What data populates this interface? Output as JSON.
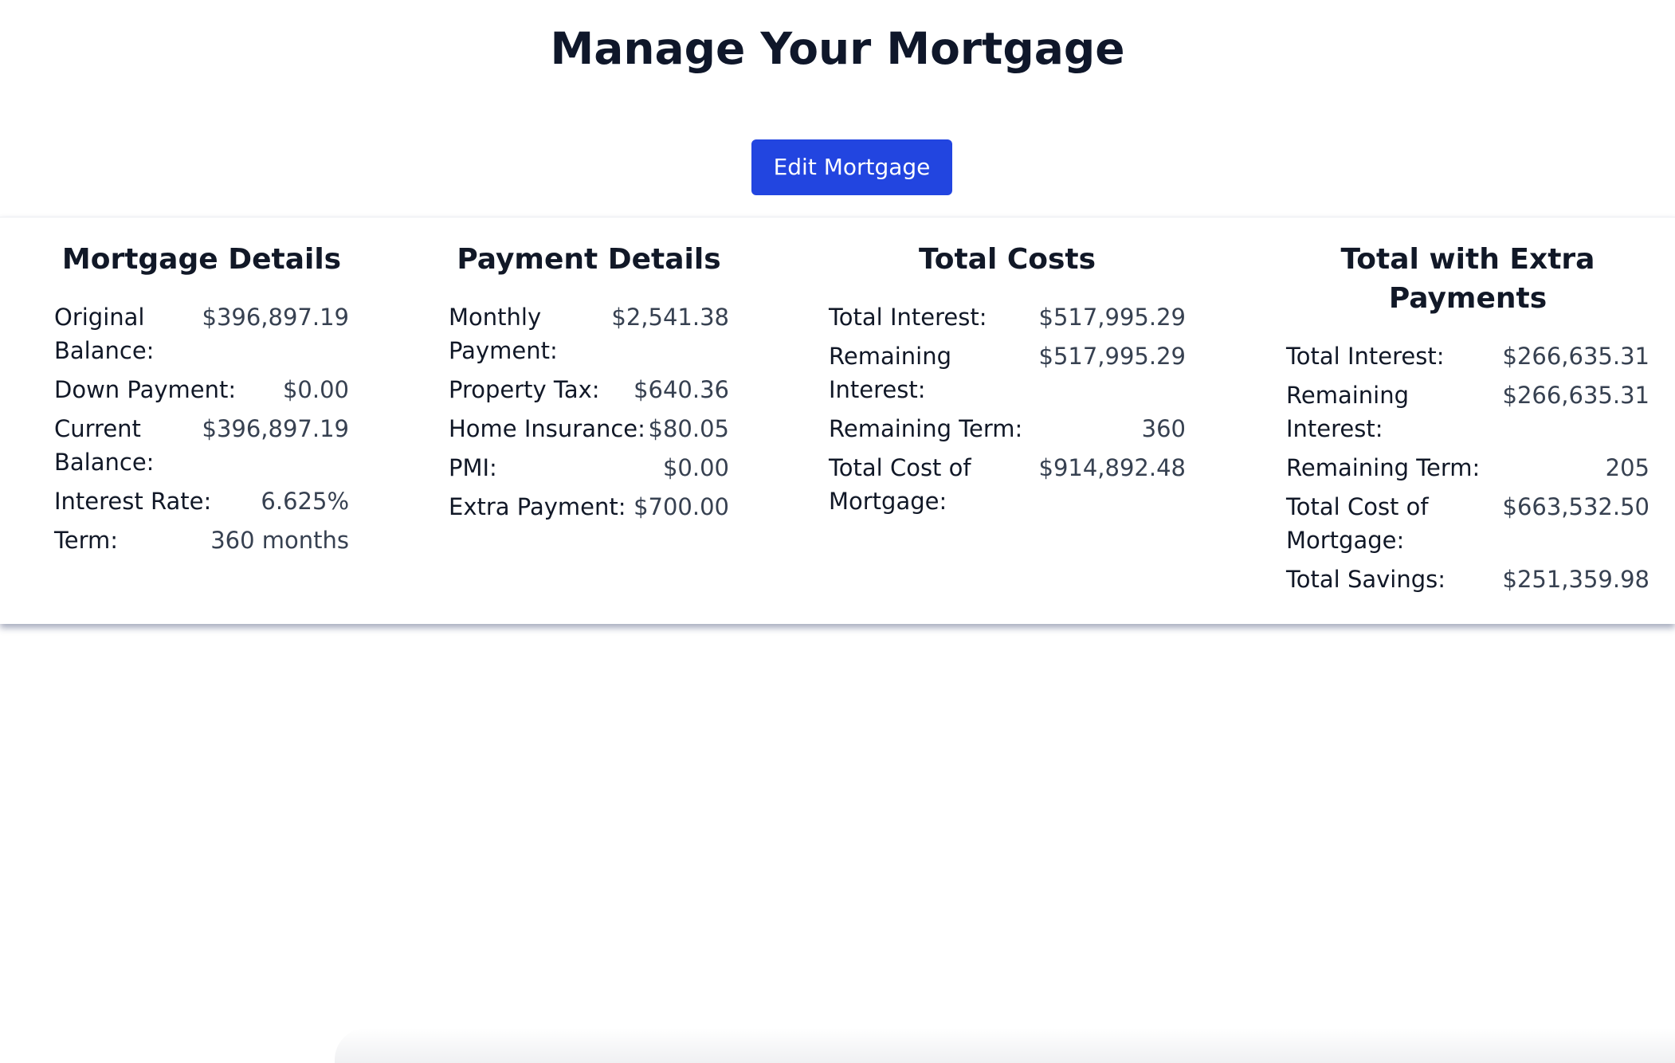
{
  "page": {
    "title": "Manage Your Mortgage",
    "edit_button_label": "Edit Mortgage",
    "colors": {
      "accent": "#2245e0",
      "heading": "#111827",
      "value_text": "#374151",
      "background": "#ffffff"
    }
  },
  "sections": {
    "mortgage_details": {
      "title": "Mortgage Details",
      "rows": [
        {
          "label": "Original Balance:",
          "value": "$396,897.19"
        },
        {
          "label": "Down Payment:",
          "value": "$0.00"
        },
        {
          "label": "Current Balance:",
          "value": "$396,897.19"
        },
        {
          "label": "Interest Rate:",
          "value": "6.625%"
        },
        {
          "label": "Term:",
          "value": "360 months"
        }
      ]
    },
    "payment_details": {
      "title": "Payment Details",
      "rows": [
        {
          "label": "Monthly Payment:",
          "value": "$2,541.38"
        },
        {
          "label": "Property Tax:",
          "value": "$640.36"
        },
        {
          "label": "Home Insurance:",
          "value": "$80.05"
        },
        {
          "label": "PMI:",
          "value": "$0.00"
        },
        {
          "label": "Extra Payment:",
          "value": "$700.00"
        }
      ]
    },
    "total_costs": {
      "title": "Total Costs",
      "rows": [
        {
          "label": "Total Interest:",
          "value": "$517,995.29"
        },
        {
          "label": "Remaining Interest:",
          "value": "$517,995.29"
        },
        {
          "label": "Remaining Term:",
          "value": "360"
        },
        {
          "label": "Total Cost of Mortgage:",
          "value": "$914,892.48"
        }
      ]
    },
    "total_extra": {
      "title": "Total with Extra Payments",
      "rows": [
        {
          "label": "Total Interest:",
          "value": "$266,635.31"
        },
        {
          "label": "Remaining Interest:",
          "value": "$266,635.31"
        },
        {
          "label": "Remaining Term:",
          "value": "205"
        },
        {
          "label": "Total Cost of Mortgage:",
          "value": "$663,532.50"
        },
        {
          "label": "Total Savings:",
          "value": "$251,359.98"
        }
      ]
    }
  }
}
